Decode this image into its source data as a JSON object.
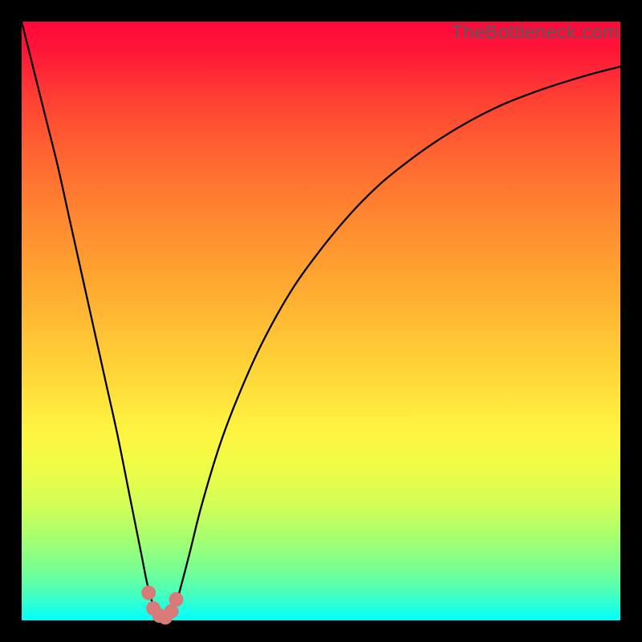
{
  "watermark": "TheBottleneck.com",
  "colors": {
    "frame": "#000000",
    "curve_stroke": "#000000",
    "marker_fill": "#d77a78",
    "marker_stroke": "#d77a78",
    "watermark_text": "#58595b",
    "gradient_top": "#ff073a",
    "gradient_bottom": "#00fffc"
  },
  "chart_data": {
    "type": "line",
    "title": "",
    "xlabel": "",
    "ylabel": "",
    "xlim": [
      0,
      100
    ],
    "ylim": [
      0,
      100
    ],
    "grid": false,
    "legend": false,
    "series": [
      {
        "name": "bottleneck-curve",
        "x": [
          0,
          2,
          4,
          6,
          8,
          10,
          12,
          14,
          16,
          18,
          20,
          21,
          22,
          23,
          24,
          25,
          26,
          28,
          30,
          33,
          36,
          40,
          45,
          50,
          55,
          60,
          65,
          70,
          75,
          80,
          85,
          90,
          95,
          100
        ],
        "y": [
          100,
          92,
          84,
          76,
          67,
          58,
          49,
          40,
          31,
          21,
          11,
          6,
          2.5,
          0.8,
          0.4,
          1.0,
          3.5,
          11,
          19,
          29,
          37,
          46,
          55,
          62,
          68,
          73,
          77,
          80.5,
          83.5,
          86,
          88,
          89.7,
          91.2,
          92.5
        ]
      }
    ],
    "markers": [
      {
        "x": 21.2,
        "y": 4.6
      },
      {
        "x": 22.0,
        "y": 2.0
      },
      {
        "x": 23.0,
        "y": 0.8
      },
      {
        "x": 24.0,
        "y": 0.5
      },
      {
        "x": 25.0,
        "y": 1.5
      },
      {
        "x": 25.8,
        "y": 3.5
      }
    ],
    "heat_gradient": {
      "direction": "vertical",
      "stops": [
        {
          "pos": 0.0,
          "color": "#ff073a"
        },
        {
          "pos": 0.3,
          "color": "#ff8530"
        },
        {
          "pos": 0.6,
          "color": "#ffe53d"
        },
        {
          "pos": 0.8,
          "color": "#d0fe57"
        },
        {
          "pos": 1.0,
          "color": "#00fffc"
        }
      ]
    }
  }
}
